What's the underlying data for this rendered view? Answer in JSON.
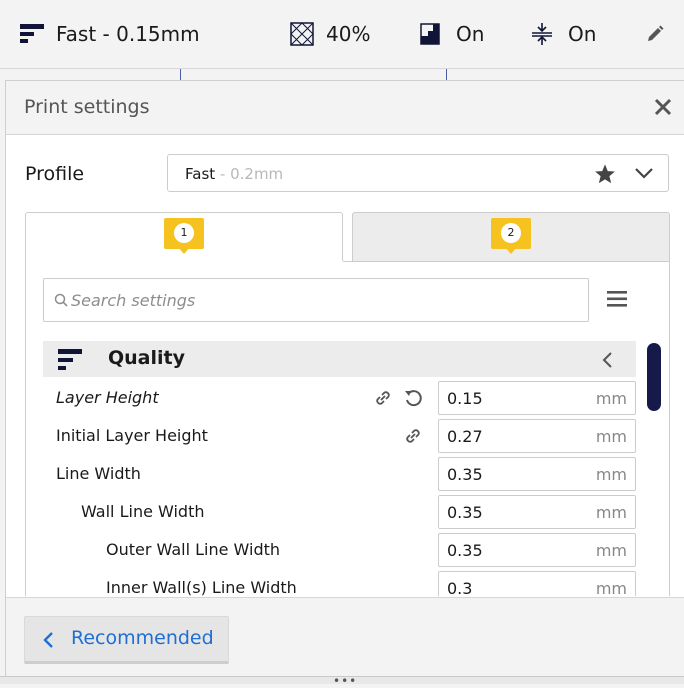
{
  "topbar": {
    "profile": "Fast - 0.15mm",
    "infill": "40%",
    "support": "On",
    "adhesion": "On"
  },
  "panel": {
    "title": "Print settings",
    "profile_label": "Profile",
    "profile_value": "Fast",
    "profile_sub": " - 0.2mm",
    "tabs": [
      {
        "badge": "1"
      },
      {
        "badge": "2"
      }
    ],
    "search_placeholder": "Search settings",
    "category": "Quality",
    "settings": [
      {
        "label": "Layer Height",
        "value": "0.15",
        "unit": "mm"
      },
      {
        "label": "Initial Layer Height",
        "value": "0.27",
        "unit": "mm"
      },
      {
        "label": "Line Width",
        "value": "0.35",
        "unit": "mm"
      },
      {
        "label": "Wall Line Width",
        "value": "0.35",
        "unit": "mm"
      },
      {
        "label": "Outer Wall Line Width",
        "value": "0.35",
        "unit": "mm"
      },
      {
        "label": "Inner Wall(s) Line Width",
        "value": "0.3",
        "unit": "mm"
      }
    ],
    "footer_button": "Recommended"
  },
  "colors": {
    "accent_blue": "#1f6ed4",
    "badge_yellow": "#f5c220",
    "scrollbar_navy": "#161a4a"
  },
  "icons": [
    "profile-icon",
    "infill-icon",
    "support-icon",
    "adhesion-icon",
    "pencil-icon",
    "close-icon",
    "star-icon",
    "chevron-down-icon",
    "search-icon",
    "hamburger-menu-icon",
    "quality-icon",
    "chevron-left-icon",
    "link-icon",
    "reset-icon"
  ]
}
